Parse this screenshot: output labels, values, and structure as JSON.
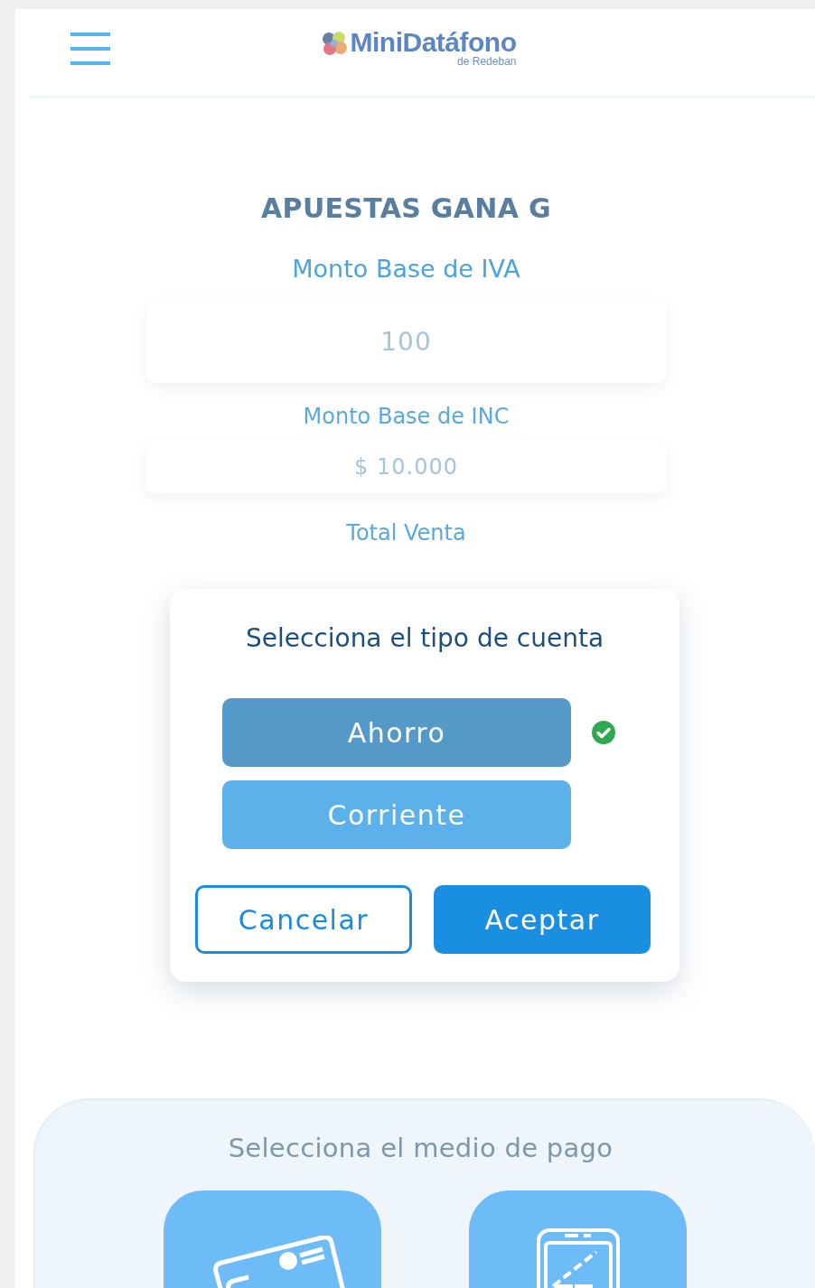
{
  "header": {
    "logo_text": "MiniDatáfono",
    "logo_subtext": "de Redeban"
  },
  "merchant": "APUESTAS GANA G",
  "fields": [
    {
      "label": "Monto Base de IVA",
      "value": "100",
      "kind": "large"
    },
    {
      "label": "Monto Base de INC",
      "value": "$ 10.000",
      "kind": "compact"
    }
  ],
  "total_label": "Total Venta",
  "dialog": {
    "title": "Selecciona el tipo de cuenta",
    "options": [
      {
        "label": "Ahorro",
        "selected": true
      },
      {
        "label": "Corriente",
        "selected": false
      }
    ],
    "buttons": [
      {
        "label": "Cancelar",
        "kind": "outline"
      },
      {
        "label": "Aceptar",
        "kind": "primary"
      }
    ]
  },
  "payment": {
    "title": "Selecciona el medio de pago",
    "methods": [
      {
        "kind": "card"
      },
      {
        "kind": "phone"
      }
    ]
  }
}
